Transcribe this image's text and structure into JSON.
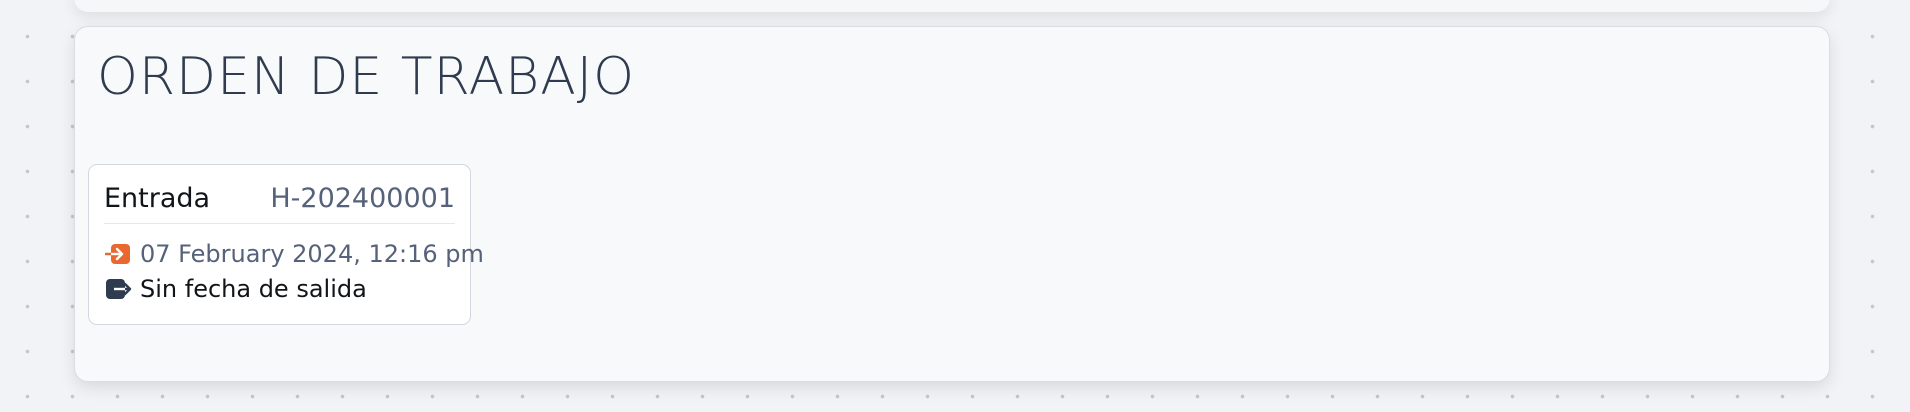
{
  "page": {
    "title": "ORDEN DE TRABAJO"
  },
  "entry": {
    "label": "Entrada",
    "code": "H-202400001",
    "entry_icon": "enter-icon",
    "entry_datetime": "07 February 2024, 12:16 pm",
    "exit_icon": "exit-icon",
    "exit_text": "Sin fecha de salida"
  },
  "colors": {
    "background": "#f1f3f6",
    "card": "#f8f9fb",
    "title": "#2f3b4e",
    "entry_icon": "#e8682f",
    "exit_icon": "#2f3b4e",
    "muted_text": "#56627a"
  }
}
